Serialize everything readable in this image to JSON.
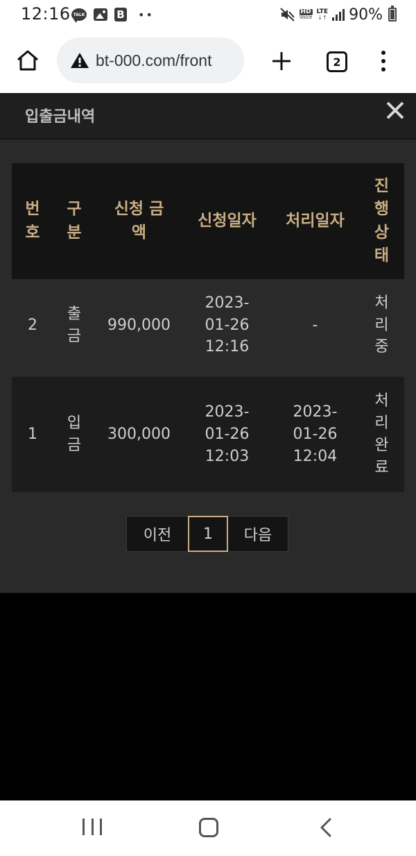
{
  "status_bar": {
    "time": "12:16",
    "talk_icon_text": "TALK",
    "b_icon_text": "B",
    "hd_text": "HD",
    "voice_text": "Voice",
    "lte_text": "LTE",
    "battery": "90%"
  },
  "browser": {
    "url": "bt-000.com/front",
    "tab_count": "2"
  },
  "modal": {
    "title": "입출금내역",
    "close_label": "✕"
  },
  "table": {
    "headers": [
      "번\n호",
      "구\n분",
      "신청 금\n액",
      "신청일자",
      "처리일자",
      "진\n행\n상\n태"
    ],
    "rows": [
      [
        "2",
        "출\n금",
        "990,000",
        "2023-\n01-26\n12:16",
        "-",
        "처\n리\n중"
      ],
      [
        "1",
        "입\n금",
        "300,000",
        "2023-\n01-26\n12:03",
        "2023-\n01-26\n12:04",
        "처\n리\n완\n료"
      ]
    ]
  },
  "pagination": {
    "prev": "이전",
    "current": "1",
    "next": "다음"
  }
}
